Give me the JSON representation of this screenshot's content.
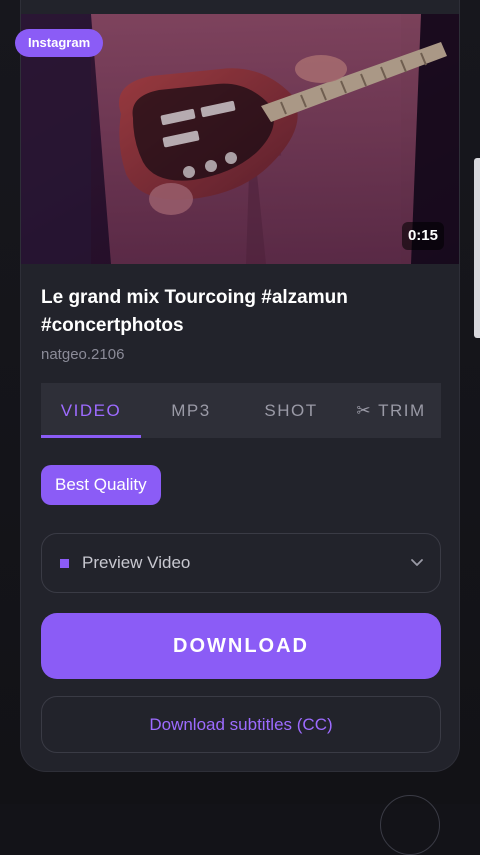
{
  "video": {
    "source_badge": "Instagram",
    "duration": "0:15",
    "title": "Le grand mix Tourcoing #alzamun #concertphotos",
    "author": "natgeo.2106"
  },
  "tabs": [
    {
      "label": "VIDEO",
      "active": true
    },
    {
      "label": "MP3",
      "active": false
    },
    {
      "label": "SHOT",
      "active": false
    },
    {
      "label": "TRIM",
      "active": false,
      "icon": "scissors-icon"
    }
  ],
  "quality": {
    "label": "Best Quality"
  },
  "format_select": {
    "selected": "Preview Video",
    "icon": "chevron-down-icon"
  },
  "actions": {
    "download_label": "DOWNLOAD",
    "subtitles_label": "Download subtitles (CC)"
  },
  "colors": {
    "accent": "#8b5cf6",
    "card": "#22232b",
    "background": "#131318"
  }
}
